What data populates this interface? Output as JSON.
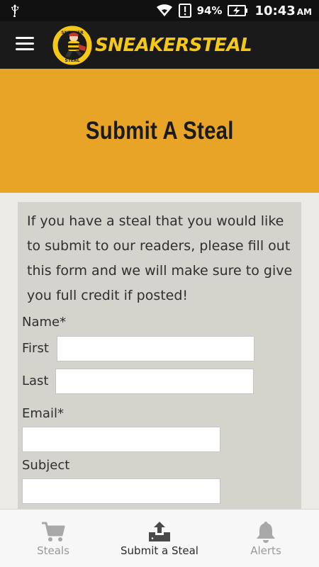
{
  "status_bar": {
    "usb_icon": "usb-icon",
    "wifi_icon": "wifi-icon",
    "notification_icon": "alert-notification-icon",
    "battery_percent": "94%",
    "battery_icon": "battery-charging-icon",
    "time": "10:43",
    "ampm": "AM"
  },
  "app_bar": {
    "menu_icon": "hamburger-menu-icon",
    "logo_text": "SNEAKERSTEAL",
    "logo_mark_top": "SNEAKER",
    "logo_mark_bottom": "STEAL",
    "brand_color": "#f6c816"
  },
  "banner": {
    "title": "Submit A Steal",
    "color": "#e7a426"
  },
  "form": {
    "intro": "If you have a steal that you would like to submit to our readers, please fill out this form and we will make sure to give you full credit if posted!",
    "name_label": "Name*",
    "first_label": "First",
    "first_value": "",
    "last_label": "Last",
    "last_value": "",
    "email_label": "Email*",
    "email_value": "",
    "subject_label": "Subject",
    "subject_value": ""
  },
  "bottom_nav": {
    "items": [
      {
        "label": "Steals",
        "icon": "shopping-cart-icon",
        "active": false
      },
      {
        "label": "Submit a Steal",
        "icon": "upload-icon",
        "active": true
      },
      {
        "label": "Alerts",
        "icon": "bell-icon",
        "active": false
      }
    ]
  }
}
